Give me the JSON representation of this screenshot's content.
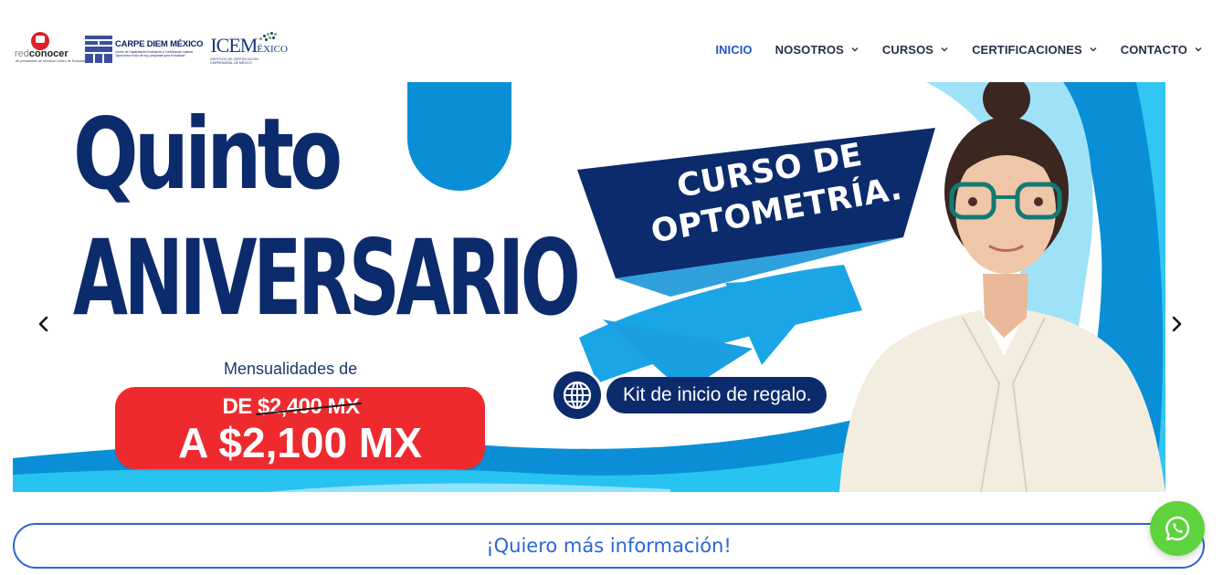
{
  "header": {
    "logos": {
      "red_conocer": {
        "part1": "red",
        "part2": "conocer",
        "subtitle": "de prestadores de servicios Centro de Evaluación"
      },
      "carpe_diem": {
        "title": "CARPE DIEM MÉXICO",
        "line1": "Centro de Capacitación Evaluación y Certificación Laboral",
        "line2": "\"Aprovecha el día de hoy, prepárate para el mañana\""
      },
      "icem": {
        "main": "ICEM",
        "small": "ÉXICO",
        "subtitle": "INSTITUTO DE CERTIFICACIÓN EMPRESARIAL DE MÉXICO"
      }
    },
    "nav": [
      {
        "label": "INICIO",
        "active": true,
        "dropdown": false
      },
      {
        "label": "NOSOTROS",
        "active": false,
        "dropdown": true
      },
      {
        "label": "CURSOS",
        "active": false,
        "dropdown": true
      },
      {
        "label": "CERTIFICACIONES",
        "active": false,
        "dropdown": true
      },
      {
        "label": "CONTACTO",
        "active": false,
        "dropdown": true
      }
    ]
  },
  "hero": {
    "headline_line1": "Quinto",
    "headline_line2": "ANIVERSARIO",
    "ribbon_line1": "CURSO DE",
    "ribbon_line2": "OPTOMETRÍA.",
    "installments_label": "Mensualidades de",
    "old_price_prefix": "DE ",
    "old_price": "$2,400 MX",
    "new_price": "A  $2,100 MX",
    "kit_text": "Kit de inicio de regalo.",
    "prev_icon": "chevron-left-icon",
    "next_icon": "chevron-right-icon"
  },
  "cta": {
    "label": "¡Quiero más información!"
  },
  "whatsapp": {
    "icon": "whatsapp-icon"
  },
  "colors": {
    "nav_active": "#2354c8",
    "nav_text": "#253246",
    "brand_navy": "#0c2b6c",
    "brand_blue": "#0a90d8",
    "price_red": "#ee2a2f",
    "cta_blue": "#2b64d6",
    "whatsapp_green": "#5fd33d"
  }
}
